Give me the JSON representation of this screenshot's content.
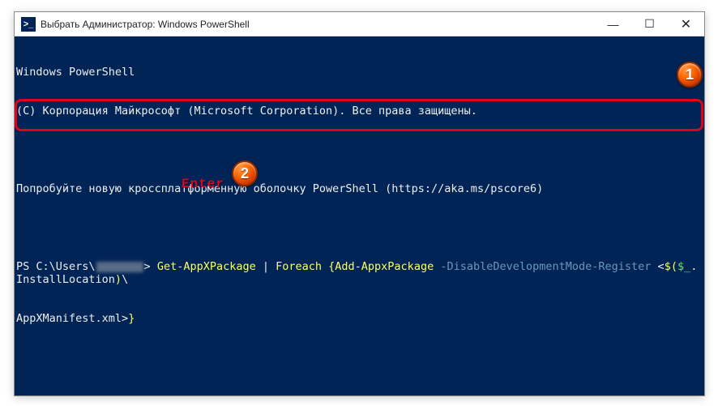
{
  "window": {
    "icon_glyph": ">_",
    "title": "Выбрать Администратор: Windows PowerShell"
  },
  "winbtns": {
    "min": "—",
    "max": "☐",
    "close": "✕"
  },
  "terminal": {
    "line1": "Windows PowerShell",
    "line2": "(C) Корпорация Майкрософт (Microsoft Corporation). Все права защищены.",
    "line3": "Попробуйте новую кроссплатформенную оболочку PowerShell (https://aka.ms/pscore6)",
    "prompt_prefix": "PS C:\\Users\\",
    "prompt_gt": "> ",
    "cmd1": "Get-AppXPackage",
    "pipe": " | ",
    "cmd2": "Foreach {",
    "cmd3": "Add-AppxPackage ",
    "flag": "-DisableDevelopmentMode-Register ",
    "lt": "<",
    "dollar": "$(",
    "var": "$_",
    "prop": ".InstallLocation",
    "close1": ")",
    "tail": "\\",
    "line5a": "AppXManifest.xml",
    "line5b": ">",
    "line5c": "}"
  },
  "annotations": {
    "badge1": "1",
    "badge2": "2",
    "enter": "Enter"
  }
}
